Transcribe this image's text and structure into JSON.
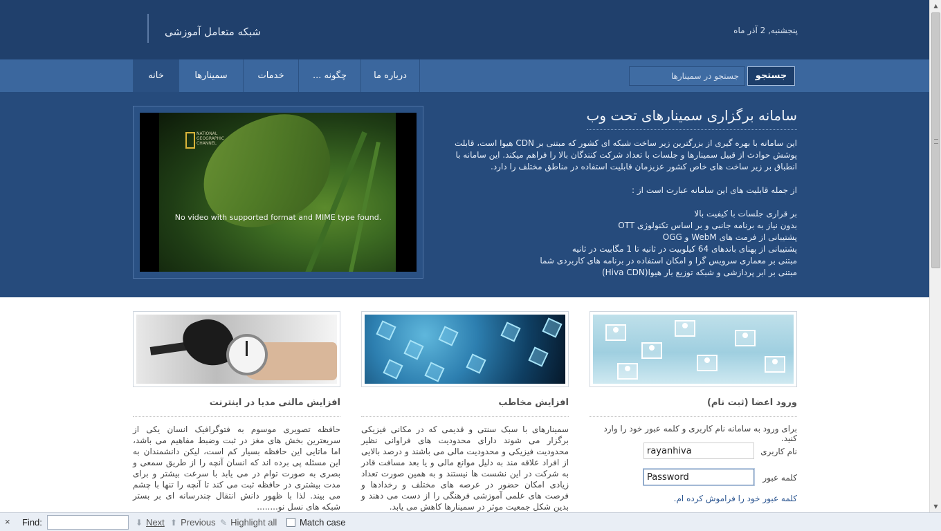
{
  "header": {
    "site_title": "شبکه متعامل آموزشی",
    "date": "پنجشنبه, 2 آذر ماه"
  },
  "nav": {
    "items": [
      {
        "label": "خانه",
        "active": true
      },
      {
        "label": "سمینارها"
      },
      {
        "label": "خدمات"
      },
      {
        "label": "چگونه ..."
      },
      {
        "label": "درباره ما"
      }
    ],
    "search_button": "جستجو",
    "search_placeholder": "جستجو در سمینارها"
  },
  "hero": {
    "title": "سامانه برگزاری سمینارهای تحت وب",
    "intro": "این سامانه با بهره گیری از بزرگترین زیر ساخت شبکه ای کشور که مبتنی بر CDN هیوا است، قابلت پوشش حوادث از قبیل سمینارها و جلسات با تعداد شرکت کنندگان بالا را فراهم میکند. این سامانه با انطباق بر زیر ساخت های خاص کشور عزیزمان قابلیت استفاده در مناطق مختلف را دارد.",
    "features_heading": "از جمله قابلیت های این سامانه عبارت است از :",
    "features": [
      "بر قراری جلسات با کیفیت بالا",
      "بدون نیاز به برنامه جانبی و بر اساس تکنولوژی OTT",
      "پشتیبانی از فرمت های WebM و OGG",
      "پشتیبانی از پهنای باندهای 64 کیلوبیت در ثانیه تا 1 مگابیت در ثانیه",
      "مبتنی بر معماری سرویس گرا و امکان استفاده در برنامه های کاربردی شما",
      "مبتنی بر ابر پردازشی و شبکه توزیع بار هیوا(Hiva CDN)"
    ],
    "video_message": "No video with supported format and MIME type found.",
    "video_logo_text": "NATIONAL GEOGRAPHIC CHANNEL"
  },
  "columns": {
    "login": {
      "title": "ورود اعضا (ثبت نام)",
      "intro": "برای ورود به سامانه نام کاربری و کلمه عبور خود را وارد کنید.",
      "username_label": "نام کاربری",
      "username_value": "rayanhiva",
      "password_label": "کلمه عبور",
      "password_value": "Password",
      "forgot_link": "کلمه عبور خود را فراموش کرده ام."
    },
    "audience": {
      "title": "افزایش مخاطب",
      "body": "سمینارهای با سبک سنتی و قدیمی که در مکانی فیزیکی برگزار می شوند دارای محدودیت های فراوانی نظیر محدودیت فیزیکی و محدودیت مالی می باشند و درصد بالایی از افراد علاقه مند به دلیل موانع مالی و یا بعد مسافت قادر به شرکت در این نشست ها نیستند و به همین صورت تعداد زیادی امکان حضور در عرصه های مختلف و رخدادها و فرصت های علمی آموزشی فرهنگی را از دست می دهند و بدین شکل جمعیت موثر در سمینارها کاهش می یابد."
    },
    "media": {
      "title": "افزایش مالنی مدیا در اینترنت",
      "body": "حافظه تصویری موسوم به فتوگرافیک انسان یکی از سریعترین بخش های مغز در ثبت وضبط مفاهیم می باشد، اما ماتایی این حافظه بسیار کم است، لیکن دانشمندان به این مسئله پی برده اند که انسان آنچه را از طریق سمعی و بصری به صورت توام در می یابد با سرعت بیشتر و برای مدت بیشتری در حافظه ثبت می کند تا آنچه را تنها با چشم می بیند. لذا با ظهور دانش انتقال چندرسانه ای بر بستر شبکه های نسل نو........"
    }
  },
  "findbar": {
    "close": "×",
    "label": "Find:",
    "next": "Next",
    "previous": "Previous",
    "highlight_all": "Highlight all",
    "match_case": "Match case"
  },
  "colors": {
    "header_bg": "#20406c",
    "nav_bg": "#3b679e",
    "hero_bg": "#264b7c",
    "link": "#2b5590"
  }
}
